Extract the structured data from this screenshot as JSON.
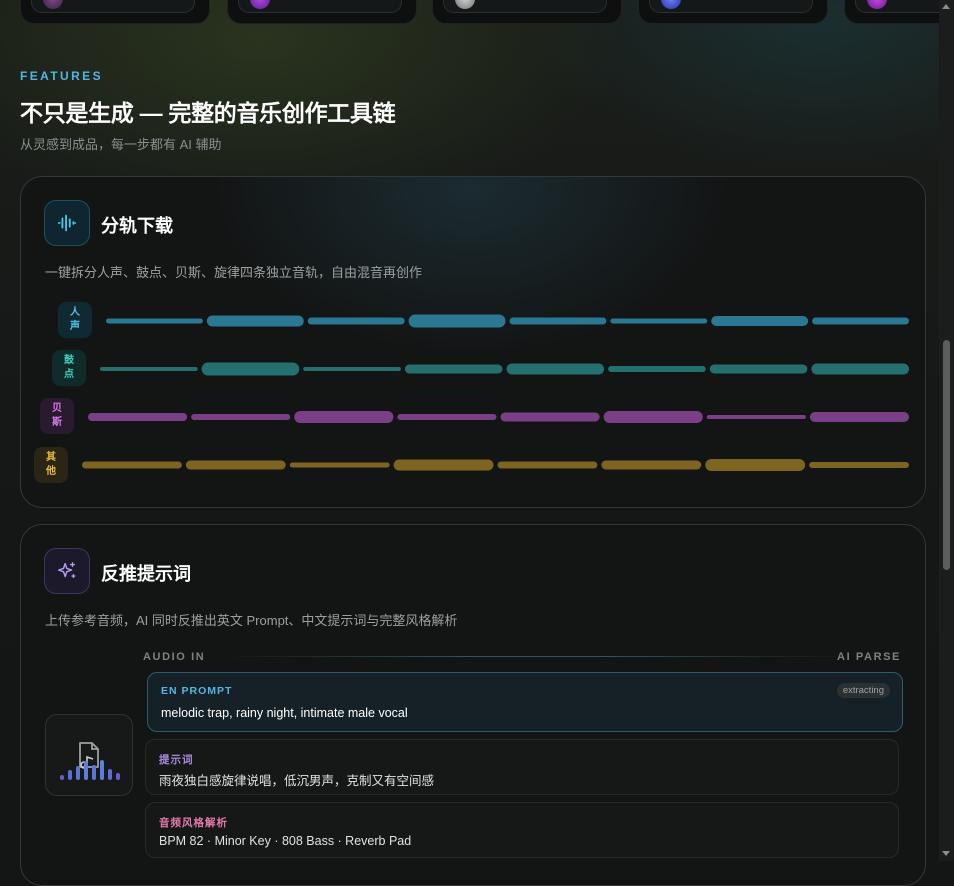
{
  "section": {
    "eyebrow": "FEATURES",
    "title": "不只是生成 — 完整的音乐创作工具链",
    "subtitle": "从灵感到成品，每一步都有 AI 辅助"
  },
  "stems_card": {
    "title": "分轨下载",
    "description": "一键拆分人声、鼓点、贝斯、旋律四条独立音轨，自由混音再创作",
    "tracks": [
      {
        "label_top": "人",
        "label_bottom": "声",
        "color": "#2a7892",
        "badge_bg": "#0f2a33",
        "badge_fg": "#4fc3e6"
      },
      {
        "label_top": "鼓",
        "label_bottom": "点",
        "color": "#23706e",
        "badge_bg": "#0f2b2a",
        "badge_fg": "#3fcfc0"
      },
      {
        "label_top": "贝",
        "label_bottom": "斯",
        "color": "#7a3f86",
        "badge_bg": "#2a1a30",
        "badge_fg": "#d77be8"
      },
      {
        "label_top": "其",
        "label_bottom": "他",
        "color": "#7d6420",
        "badge_bg": "#2a2514",
        "badge_fg": "#e8bb3f"
      }
    ]
  },
  "prompt_card": {
    "title": "反推提示词",
    "description": "上传参考音频，AI 同时反推出英文 Prompt、中文提示词与完整风格解析",
    "audio_in_label": "AUDIO IN",
    "ai_parse_label": "AI PARSE",
    "boxes": [
      {
        "label": "EN PROMPT",
        "text": "melodic trap, rainy night, intimate male vocal",
        "tag": "extracting",
        "label_color": "#4fb6e6"
      },
      {
        "label": "提示词",
        "text": "雨夜独白感旋律说唱，低沉男声，克制又有空间感",
        "label_color": "#a98be0"
      },
      {
        "label": "音频风格解析",
        "text": "BPM 82 · Minor Key · 808 Bass · Reverb Pad",
        "label_color": "#e07aa8"
      }
    ]
  },
  "colors": {
    "accent": "#4fb6e6",
    "background": "#141616"
  },
  "icons": {
    "stems": "waveform-icon",
    "prompt": "sparkles-icon",
    "audio": "audio-file-icon"
  }
}
